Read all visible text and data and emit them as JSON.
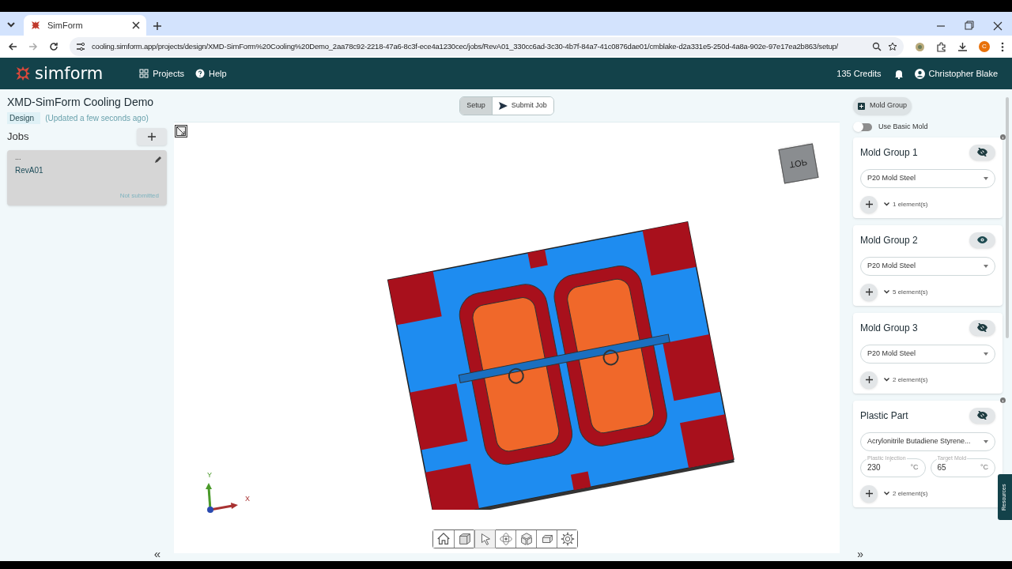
{
  "browser": {
    "tab_title": "SimForm",
    "url": "cooling.simform.app/projects/design/XMD-SimForm%20Cooling%20Demo_2aa78c92-2218-47a6-8c3f-ece4a1230cec/jobs/RevA01_330cc6ad-3c30-4b7f-84a7-41c0876dae01/cmblake-d2a331e5-250d-4a8a-902e-97e17ea2b863/setup/",
    "profile_initial": "C"
  },
  "app_nav": {
    "logo": "simform",
    "links": [
      "Projects",
      "Help"
    ],
    "credits": "135 Credits",
    "user": "Christopher Blake"
  },
  "project": {
    "title": "XMD-SimForm Cooling Demo",
    "stage": "Design",
    "updated": "(Updated a few seconds ago)"
  },
  "steps": [
    {
      "label": "Setup",
      "selected": true
    },
    {
      "label": "Submit Job",
      "selected": false
    }
  ],
  "jobs": {
    "title": "Jobs",
    "items": [
      {
        "menu": "...",
        "name": "RevA01",
        "status": "Not submitted"
      }
    ]
  },
  "viewer": {
    "view_cube": "TOP",
    "axes": [
      "X",
      "Y"
    ],
    "tools": [
      {
        "kind": "home",
        "selected": false
      },
      {
        "kind": "cube",
        "selected": false
      },
      {
        "kind": "pointer",
        "selected": true
      },
      {
        "kind": "orbit",
        "selected": false
      },
      {
        "kind": "explode",
        "selected": false
      },
      {
        "kind": "box",
        "selected": false
      },
      {
        "kind": "settings",
        "selected": false
      }
    ]
  },
  "right_panel": {
    "add_button": "Mold Group",
    "basic_mold": {
      "label": "Use Basic Mold",
      "on": false
    },
    "cards": [
      {
        "kind": "mold_group",
        "title": "Mold Group 1",
        "info": true,
        "visible": false,
        "material": "P20 Mold Steel",
        "elements": "1 element(s)"
      },
      {
        "kind": "mold_group",
        "title": "Mold Group 2",
        "info": false,
        "visible": true,
        "material": "P20 Mold Steel",
        "elements": "5 element(s)"
      },
      {
        "kind": "mold_group",
        "title": "Mold Group 3",
        "info": false,
        "visible": false,
        "material": "P20 Mold Steel",
        "elements": "2 element(s)"
      },
      {
        "kind": "plastic_part",
        "title": "Plastic Part",
        "info": true,
        "visible": false,
        "material": "Acrylonitrile Butadiene Styrene...",
        "temps": [
          {
            "label": "Plastic Injection",
            "value": "230",
            "unit": "°C"
          },
          {
            "label": "Target Mold",
            "value": "65",
            "unit": "°C"
          }
        ],
        "elements": "2 element(s)"
      }
    ]
  },
  "resources_tab": "Resources",
  "collapse_left": "«",
  "expand_right": "»"
}
